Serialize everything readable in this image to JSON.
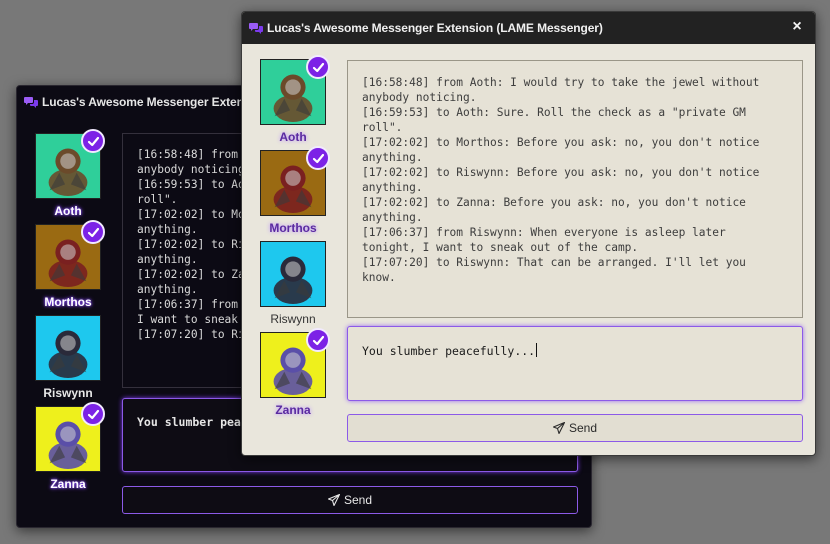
{
  "window_back": {
    "title": "Lucas's Awesome Messenger Extension (LAME Messenger)",
    "characters": [
      {
        "name": "Aoth",
        "checked": true,
        "highlighted": true,
        "bg": "#2fcf9a",
        "figure": "#6b4a2a"
      },
      {
        "name": "Morthos",
        "checked": true,
        "highlighted": true,
        "bg": "#9a6a12",
        "figure": "#7a2020"
      },
      {
        "name": "Riswynn",
        "checked": false,
        "highlighted": false,
        "bg": "#1ec8ee",
        "figure": "#2a2a3a"
      },
      {
        "name": "Zanna",
        "checked": true,
        "highlighted": true,
        "bg": "#eef01c",
        "figure": "#5a4fa8"
      }
    ],
    "log": "[16:58:48] from Aoth: I would try to take the jewel without anybody noticing.\n[16:59:53] to Aoth: Sure. Roll the check as a \"private GM roll\".\n[17:02:02] to Morthos: Before you ask: no, you don't notice anything.\n[17:02:02] to Riswynn: Before you ask: no, you don't notice anything.\n[17:02:02] to Zanna: Before you ask: no, you don't notice anything.\n[17:06:37] from Riswynn: When everyone is asleep later tonight, I want to sneak out of the camp.\n[17:07:20] to Riswynn: That can be arranged. I'll let you know.",
    "input_value": "You slumber peacefully...",
    "send_label": "Send"
  },
  "window_front": {
    "title": "Lucas's Awesome Messenger Extension (LAME Messenger)",
    "close_label": "×",
    "characters": [
      {
        "name": "Aoth",
        "checked": true,
        "highlighted": true,
        "bg": "#2fcf9a",
        "figure": "#6b4a2a"
      },
      {
        "name": "Morthos",
        "checked": true,
        "highlighted": true,
        "bg": "#9a6a12",
        "figure": "#7a2020"
      },
      {
        "name": "Riswynn",
        "checked": false,
        "highlighted": false,
        "bg": "#1ec8ee",
        "figure": "#2a2a3a"
      },
      {
        "name": "Zanna",
        "checked": true,
        "highlighted": true,
        "bg": "#eef01c",
        "figure": "#5a4fa8"
      }
    ],
    "log": "[16:58:48] from Aoth: I would try to take the jewel without\nanybody noticing.\n[16:59:53] to Aoth: Sure. Roll the check as a \"private GM\nroll\".\n[17:02:02] to Morthos: Before you ask: no, you don't notice\nanything.\n[17:02:02] to Riswynn: Before you ask: no, you don't notice\nanything.\n[17:02:02] to Zanna: Before you ask: no, you don't notice\nanything.\n[17:06:37] from Riswynn: When everyone is asleep later\ntonight, I want to sneak out of the camp.\n[17:07:20] to Riswynn: That can be arranged. I'll let you\nknow.",
    "input_value": "You slumber peacefully...",
    "send_label": "Send"
  },
  "colors": {
    "accent": "#7c22e6",
    "dark_bg": "#0c0a14",
    "parchment": "#e9e6dc",
    "desktop": "#787878"
  },
  "icons": {
    "title": "chat-bubbles-icon",
    "check": "checkmark-icon",
    "send": "paper-plane-icon",
    "close": "close-icon"
  }
}
